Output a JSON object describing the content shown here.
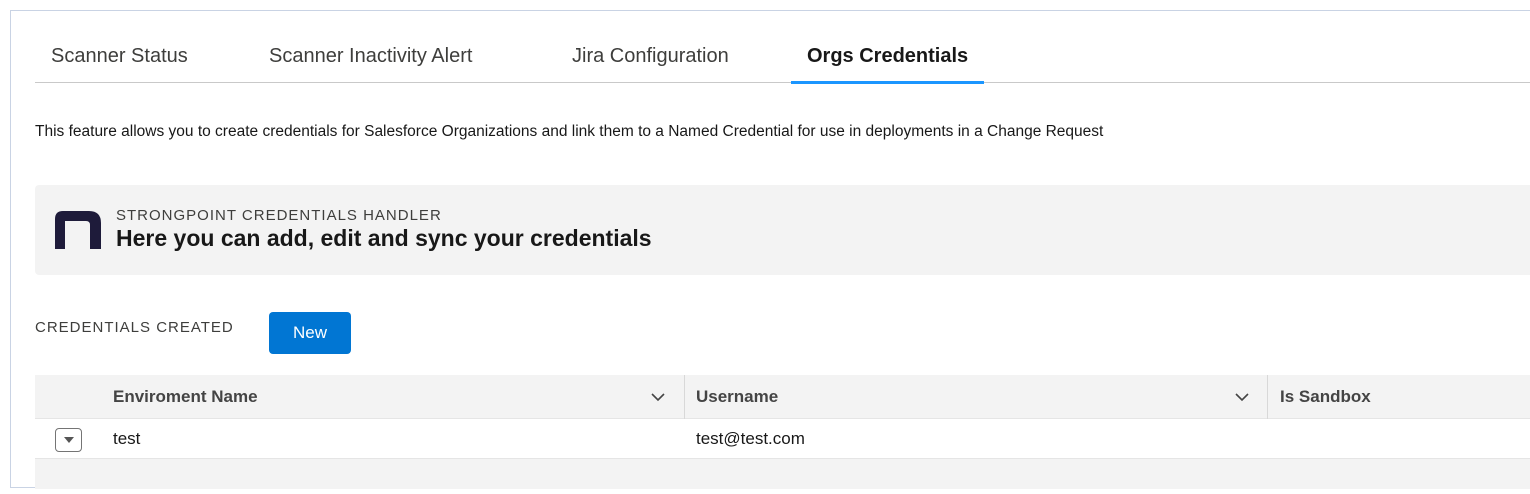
{
  "tabs": [
    {
      "label": "Scanner Status",
      "active": false
    },
    {
      "label": "Scanner Inactivity Alert",
      "active": false
    },
    {
      "label": "Jira Configuration",
      "active": false
    },
    {
      "label": "Orgs Credentials",
      "active": true
    }
  ],
  "description": "This feature allows you to create credentials for Salesforce Organizations and link them to a Named Credential for use in deployments in a Change Request",
  "banner": {
    "eyebrow": "STRONGPOINT CREDENTIALS HANDLER",
    "headline": "Here you can add, edit and sync your credentials",
    "logo_color": "#1e1b3a"
  },
  "credentials": {
    "label": "CREDENTIALS CREATED",
    "new_button": "New",
    "accent_color": "#0176d3"
  },
  "table": {
    "columns": [
      "Enviroment Name",
      "Username",
      "Is Sandbox"
    ],
    "rows": [
      {
        "name": "test",
        "username": "test@test.com",
        "sandbox": ""
      }
    ]
  }
}
